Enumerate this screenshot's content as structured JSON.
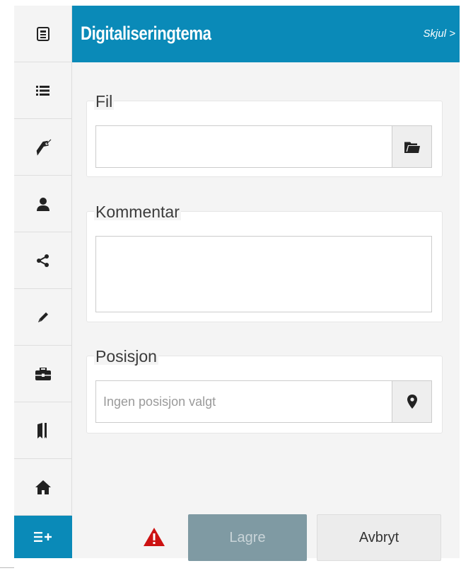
{
  "toolbar": {
    "items": [
      {
        "icon": "document-icon"
      },
      {
        "icon": "list-icon"
      },
      {
        "icon": "tag-icon"
      },
      {
        "icon": "user-icon"
      },
      {
        "icon": "share-icon"
      },
      {
        "icon": "pencil-icon"
      },
      {
        "icon": "briefcase-icon"
      },
      {
        "icon": "bookmarks-icon"
      },
      {
        "icon": "home-icon"
      },
      {
        "icon": "add-list-icon",
        "active": true
      }
    ],
    "accent_color": "#0a8ab8"
  },
  "panel": {
    "title": "Digitaliseringtema",
    "hide_label": "Skjul >",
    "file": {
      "legend": "Fil",
      "value": "",
      "button_icon": "folder-icon"
    },
    "comment": {
      "legend": "Kommentar",
      "value": ""
    },
    "position": {
      "legend": "Posisjon",
      "placeholder": "Ingen posisjon valgt",
      "button_icon": "map-marker-icon"
    }
  },
  "footer": {
    "warning_icon": "warning-icon",
    "warning_color": "#cc1111",
    "save_label": "Lagre",
    "cancel_label": "Avbryt"
  }
}
